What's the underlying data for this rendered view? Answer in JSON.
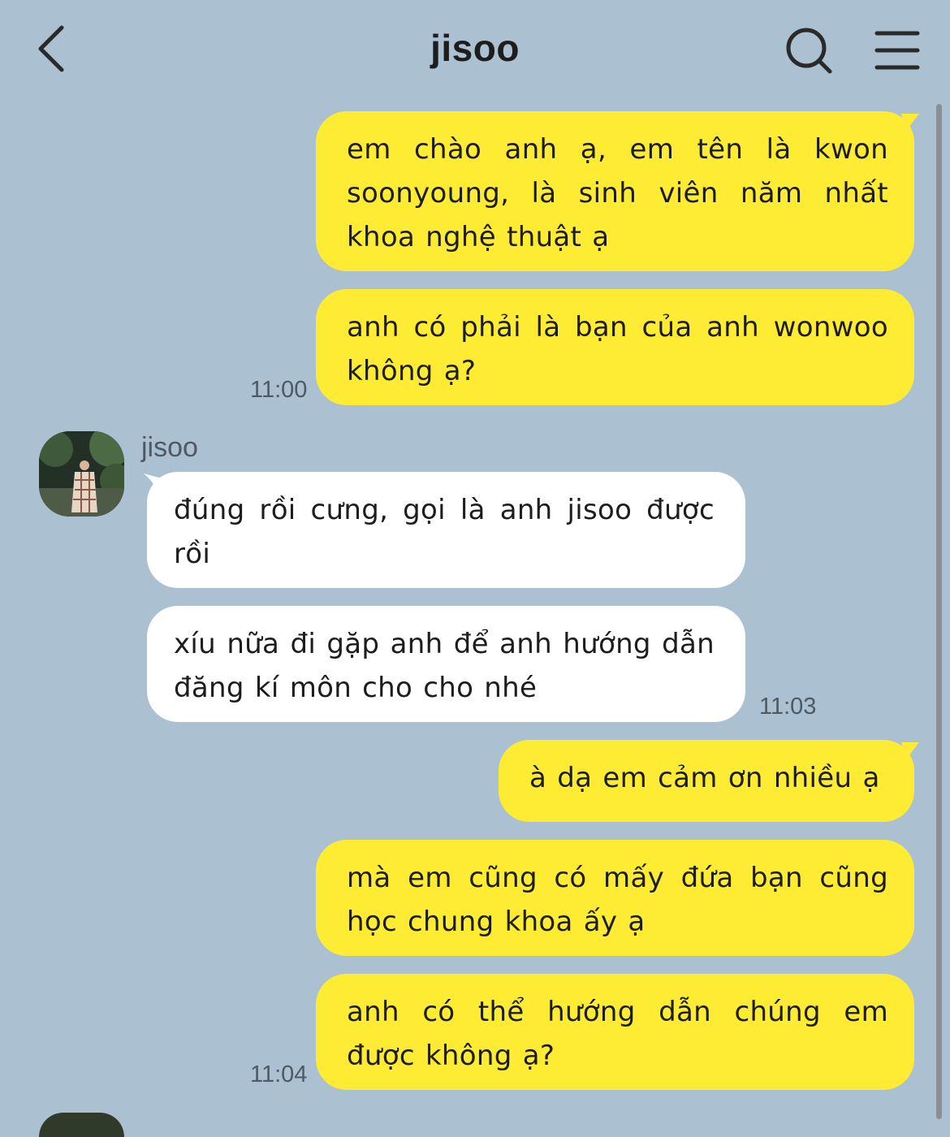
{
  "header": {
    "title": "jisoo",
    "back_icon": "chevron-left-icon",
    "search_icon": "search-icon",
    "menu_icon": "hamburger-menu-icon"
  },
  "colors": {
    "background": "#abc1d1",
    "my_bubble": "#feeb34",
    "their_bubble": "#ffffff"
  },
  "contact": {
    "name": "jisoo"
  },
  "messages": [
    {
      "sender": "me",
      "text": "em chào anh ạ, em tên là kwon soonyoung, là sinh viên năm nhất khoa nghệ thuật ạ"
    },
    {
      "sender": "me",
      "text": "anh có phải là bạn của anh wonwoo không ạ?",
      "time": "11:00"
    },
    {
      "sender": "jisoo",
      "text": "đúng rồi cưng, gọi là anh jisoo được rồi"
    },
    {
      "sender": "jisoo",
      "text": "xíu nữa đi gặp anh để anh hướng dẫn đăng kí môn cho cho nhé",
      "time": "11:03"
    },
    {
      "sender": "me",
      "text": "à dạ em cảm ơn nhiều ạ"
    },
    {
      "sender": "me",
      "text": "mà em cũng có mấy đứa bạn cũng học chung khoa ấy ạ"
    },
    {
      "sender": "me",
      "text": "anh có thể hướng dẫn chúng em được không ạ?",
      "time": "11:04"
    }
  ]
}
